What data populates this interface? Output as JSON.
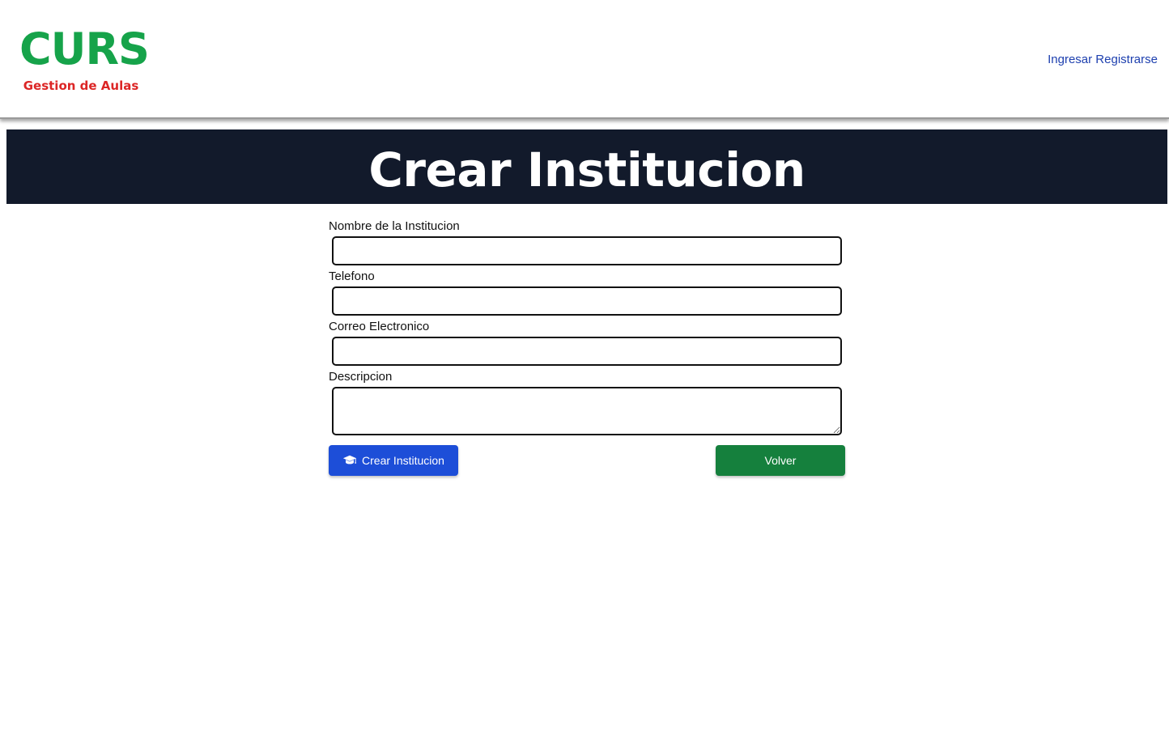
{
  "header": {
    "logo_title": "CURS",
    "logo_subtitle": "Gestion de Aulas",
    "nav": {
      "login": "Ingresar",
      "register": "Registrarse"
    }
  },
  "banner": {
    "title": "Crear Institucion"
  },
  "form": {
    "fields": [
      {
        "label": "Nombre de la Institucion",
        "value": ""
      },
      {
        "label": "Telefono",
        "value": ""
      },
      {
        "label": "Correo Electronico",
        "value": ""
      },
      {
        "label": "Descripcion",
        "value": ""
      }
    ],
    "submit_label": "Crear Institucion",
    "submit_icon": "graduation-cap-icon",
    "back_label": "Volver"
  },
  "colors": {
    "logo": "#16a34a",
    "subtitle": "#dc2626",
    "nav_link": "#1e40af",
    "banner_bg": "#121a2b",
    "submit_button": "#1d4ed8",
    "back_button": "#15803d"
  }
}
